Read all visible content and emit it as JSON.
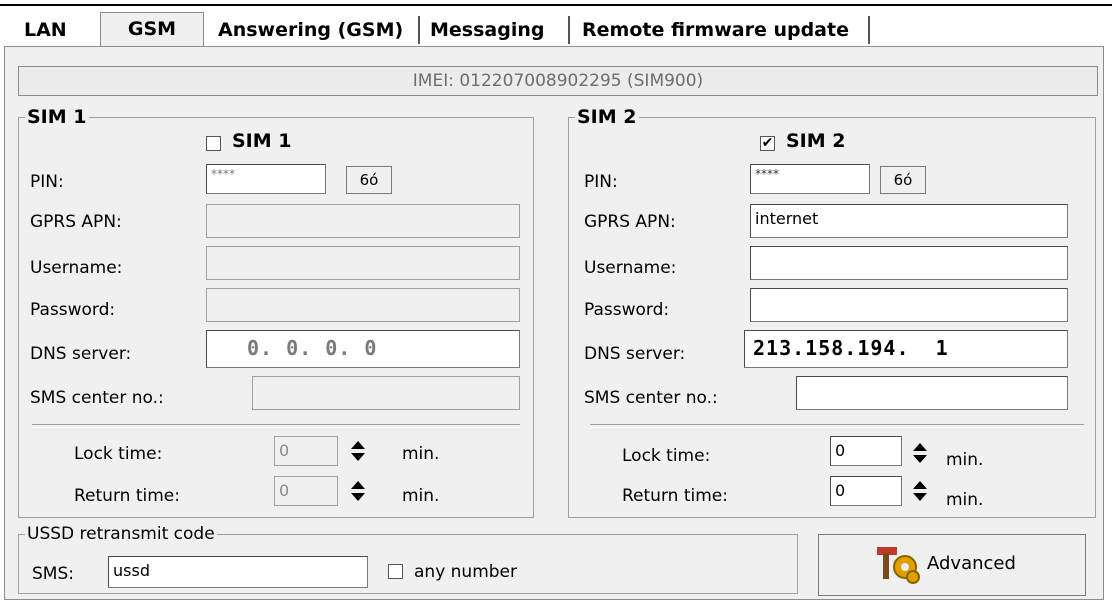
{
  "tabs": [
    {
      "label": "LAN"
    },
    {
      "label": "GSM"
    },
    {
      "label": "Answering (GSM)"
    },
    {
      "label": "Messaging"
    },
    {
      "label": "Remote firmware update"
    }
  ],
  "imei": "IMEI: 012207008902295 (SIM900)",
  "sim1": {
    "title": "SIM 1",
    "enable_label": "SIM 1",
    "enabled": false,
    "pin_label": "PIN:",
    "pin_value": "****",
    "show_pin_icon": "show-password-icon",
    "show_pin_glyph": "6ό",
    "apn_label": "GPRS APN:",
    "apn_value": "",
    "username_label": "Username:",
    "username_value": "",
    "password_label": "Password:",
    "password_value": "",
    "dns_label": "DNS server:",
    "dns_value": "0.  0.  0.  0",
    "sms_center_label": "SMS center no.:",
    "sms_center_value": "",
    "lock_label": "Lock time:",
    "lock_value": "0",
    "lock_unit": "min.",
    "return_label": "Return time:",
    "return_value": "0",
    "return_unit": "min."
  },
  "sim2": {
    "title": "SIM 2",
    "enable_label": "SIM 2",
    "enabled": true,
    "pin_label": "PIN:",
    "pin_value": "****",
    "show_pin_icon": "show-password-icon",
    "show_pin_glyph": "6ό",
    "apn_label": "GPRS APN:",
    "apn_value": "internet",
    "username_label": "Username:",
    "username_value": "",
    "password_label": "Password:",
    "password_value": "",
    "dns_label": "DNS server:",
    "dns_value": "213.158.194.  1",
    "sms_center_label": "SMS center no.:",
    "sms_center_value": "",
    "lock_label": "Lock time:",
    "lock_value": "0",
    "lock_unit": "min.",
    "return_label": "Return time:",
    "return_value": "0",
    "return_unit": "min."
  },
  "ussd": {
    "title": "USSD retransmit code",
    "sms_label": "SMS:",
    "sms_value": "ussd",
    "any_number_label": "any number",
    "any_number_checked": false
  },
  "advanced": {
    "label": "Advanced",
    "icon": "tools-gear-icon"
  },
  "colors": {
    "panel": "#f0f0f0",
    "accent_icon_gold": "#e0a000",
    "accent_icon_red": "#c0392b"
  }
}
